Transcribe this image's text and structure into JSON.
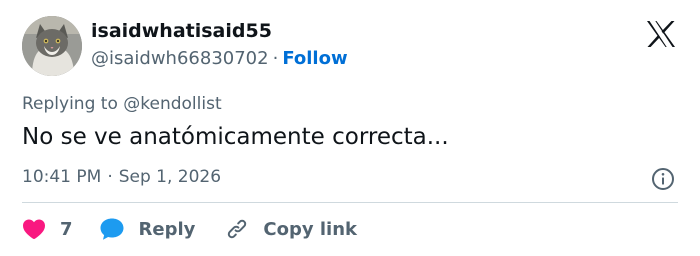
{
  "user": {
    "display_name": "isaidwhatisaid55",
    "handle": "@isaidwh66830702",
    "separator": "·",
    "follow_label": "Follow"
  },
  "reply_context": {
    "prefix": "Replying to ",
    "mention": "@kendollist"
  },
  "tweet": {
    "text": "No se ve anatómicamente correcta..."
  },
  "meta": {
    "time": "10:41 PM",
    "separator": "·",
    "date": "Sep 1, 2026"
  },
  "actions": {
    "like_count": "7",
    "reply_label": "Reply",
    "copy_link_label": "Copy link"
  },
  "icons": {
    "brand": "x-logo-icon",
    "like": "heart-icon",
    "reply": "speech-bubble-icon",
    "copy": "link-icon",
    "info": "info-icon"
  },
  "colors": {
    "text_primary": "#0f1419",
    "text_secondary": "#536471",
    "follow": "#006fd6",
    "like": "#f91880",
    "reply": "#1d9bf0",
    "divider": "#cfd9de"
  }
}
